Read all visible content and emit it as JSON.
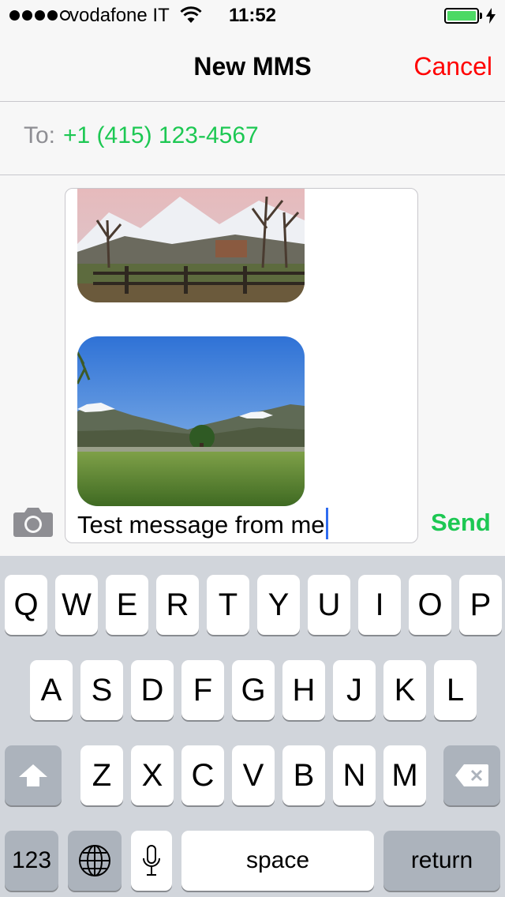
{
  "status_bar": {
    "carrier": "vodafone IT",
    "time": "11:52",
    "signal_bars_filled": 4,
    "signal_bars_total": 5,
    "battery_level": 1.0,
    "charging": true
  },
  "nav": {
    "title": "New MMS",
    "cancel_label": "Cancel"
  },
  "recipient": {
    "label": "To:",
    "value": "+1 (415) 123-4567"
  },
  "compose": {
    "attachments": [
      "photo-mountain-village",
      "photo-meadow-mountains"
    ],
    "text": "Test message from me",
    "send_label": "Send"
  },
  "keyboard": {
    "row1": [
      "Q",
      "W",
      "E",
      "R",
      "T",
      "Y",
      "U",
      "I",
      "O",
      "P"
    ],
    "row2": [
      "A",
      "S",
      "D",
      "F",
      "G",
      "H",
      "J",
      "K",
      "L"
    ],
    "row3": [
      "Z",
      "X",
      "C",
      "V",
      "B",
      "N",
      "M"
    ],
    "numbers_label": "123",
    "space_label": "space",
    "return_label": "return"
  },
  "colors": {
    "accent_green": "#1dc853",
    "cancel_red": "#ff0000",
    "keyboard_bg": "#d1d5db",
    "caret_blue": "#2f6cf0"
  }
}
